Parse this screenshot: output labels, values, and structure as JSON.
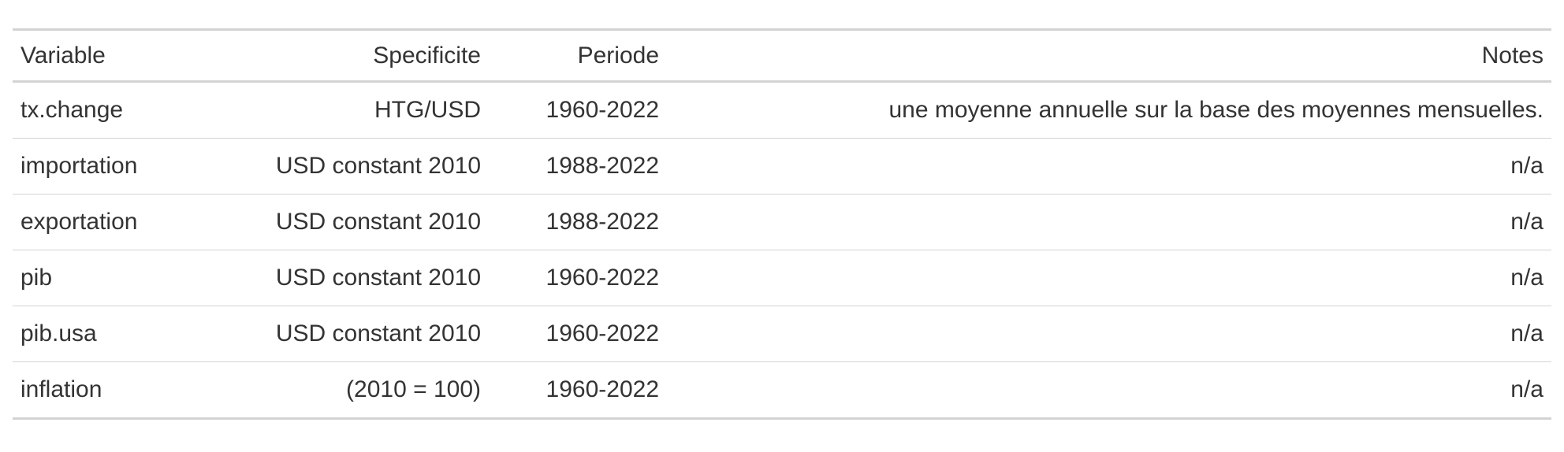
{
  "table": {
    "headers": {
      "variable": "Variable",
      "specificite": "Specificite",
      "periode": "Periode",
      "notes": "Notes"
    },
    "rows": [
      {
        "variable": "tx.change",
        "specificite": "HTG/USD",
        "periode": "1960-2022",
        "notes": "une moyenne annuelle sur la base des moyennes mensuelles."
      },
      {
        "variable": "importation",
        "specificite": "USD constant 2010",
        "periode": "1988-2022",
        "notes": "n/a"
      },
      {
        "variable": "exportation",
        "specificite": "USD constant 2010",
        "periode": "1988-2022",
        "notes": "n/a"
      },
      {
        "variable": "pib",
        "specificite": "USD constant 2010",
        "periode": "1960-2022",
        "notes": "n/a"
      },
      {
        "variable": "pib.usa",
        "specificite": "USD constant 2010",
        "periode": "1960-2022",
        "notes": "n/a"
      },
      {
        "variable": "inflation",
        "specificite": "(2010 = 100)",
        "periode": "1960-2022",
        "notes": "n/a"
      }
    ]
  }
}
